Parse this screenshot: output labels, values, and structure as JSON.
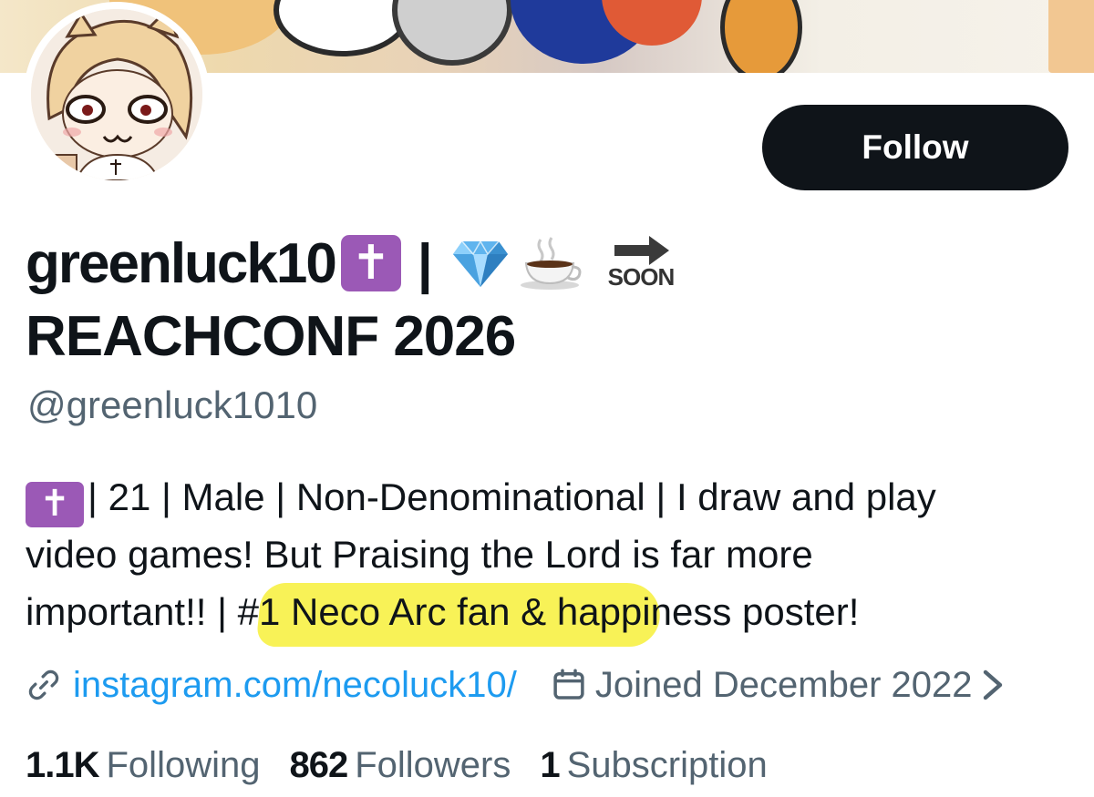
{
  "profile": {
    "display_name": "greenluck10",
    "name_cross_emoji": "✝",
    "name_separator": "|",
    "name_emojis": [
      "gem-icon",
      "coffee-icon",
      "soon-arrow-icon"
    ],
    "soon_label": "SOON",
    "display_name_line2": "REACHCONF 2026",
    "handle": "@greenluck1010",
    "follow_label": "Follow"
  },
  "bio": {
    "cross_emoji": "✝",
    "line1": "| 21 | Male | Non-Denominational | I draw and play",
    "line2": "video games! But Praising the Lord is far more",
    "line3": "important!! | #1 Neco Arc fan & happiness poster!",
    "highlight_color": "#f7f03a"
  },
  "meta": {
    "link_icon": "link-icon",
    "link_text": "instagram.com/necoluck10/",
    "calendar_icon": "calendar-icon",
    "joined_text": "Joined December 2022",
    "more_icon": "chevron-right-icon"
  },
  "stats": {
    "following_count": "1.1K",
    "following_label": "Following",
    "followers_count": "862",
    "followers_label": "Followers",
    "subscription_count": "1",
    "subscription_label": "Subscription"
  },
  "colors": {
    "text": "#0f1419",
    "secondary": "#536471",
    "link": "#1d9bf0",
    "button_bg": "#0f1419",
    "cross_bg": "#9b59b6"
  }
}
